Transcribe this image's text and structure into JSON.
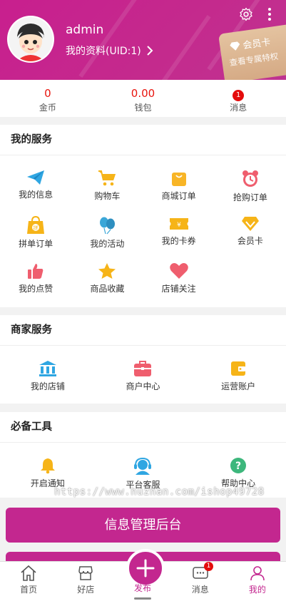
{
  "header": {
    "username": "admin",
    "profile_link": "我的资料(UID:1)",
    "vip_card": {
      "title": "会员卡",
      "subtitle": "查看专属特权"
    }
  },
  "stats": [
    {
      "value": "0",
      "label": "金币"
    },
    {
      "value": "0.00",
      "label": "钱包"
    },
    {
      "badge": "1",
      "label": "消息"
    }
  ],
  "my_services": {
    "title": "我的服务",
    "items": [
      {
        "label": "我的信息",
        "icon": "paper-plane-icon"
      },
      {
        "label": "购物车",
        "icon": "cart-icon"
      },
      {
        "label": "商城订单",
        "icon": "shopping-bag-icon"
      },
      {
        "label": "抢购订单",
        "icon": "alarm-clock-icon"
      },
      {
        "label": "拼单订单",
        "icon": "group-bag-icon"
      },
      {
        "label": "我的活动",
        "icon": "balloons-icon"
      },
      {
        "label": "我的卡券",
        "icon": "ticket-icon"
      },
      {
        "label": "会员卡",
        "icon": "diamond-icon"
      },
      {
        "label": "我的点赞",
        "icon": "thumbs-up-icon"
      },
      {
        "label": "商品收藏",
        "icon": "star-icon"
      },
      {
        "label": "店铺关注",
        "icon": "heart-icon"
      }
    ]
  },
  "merchant_services": {
    "title": "商家服务",
    "items": [
      {
        "label": "我的店铺",
        "icon": "bank-icon"
      },
      {
        "label": "商户中心",
        "icon": "briefcase-icon"
      },
      {
        "label": "运营账户",
        "icon": "wallet-icon"
      }
    ]
  },
  "tools": {
    "title": "必备工具",
    "items": [
      {
        "label": "开启通知",
        "icon": "bell-icon"
      },
      {
        "label": "平台客服",
        "icon": "headset-icon"
      },
      {
        "label": "帮助中心",
        "icon": "help-icon"
      }
    ]
  },
  "watermark": "https://www.huzhan.com/ishop49728",
  "admin_button": "信息管理后台",
  "tabbar": {
    "tabs": [
      {
        "label": "首页",
        "icon": "home-icon"
      },
      {
        "label": "好店",
        "icon": "store-icon"
      },
      {
        "label": "发布",
        "icon": "plus-icon"
      },
      {
        "label": "消息",
        "icon": "message-icon",
        "badge": "1"
      },
      {
        "label": "我的",
        "icon": "user-icon"
      }
    ]
  },
  "colors": {
    "brand": "#c3278f",
    "alert": "#e40c0c"
  }
}
